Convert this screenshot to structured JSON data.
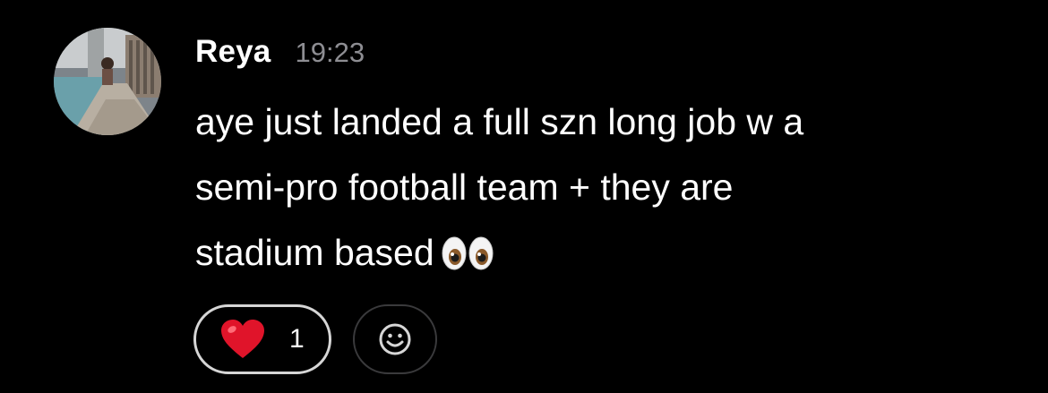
{
  "message": {
    "sender": "Reya",
    "time": "19:23",
    "text_lines": [
      "aye just landed a full szn long job w a",
      "semi-pro football team + they are",
      "stadium based"
    ],
    "trailing_emoji": "eyes-emoji"
  },
  "reactions": [
    {
      "emoji": "heart-emoji",
      "count": "1"
    }
  ],
  "add_reaction_icon": "smiley-face-icon",
  "colors": {
    "background": "#000000",
    "text": "#ffffff",
    "timestamp": "#8e8e93",
    "reaction_border": "#d6d6d6",
    "add_reaction_border": "#3a3a3c",
    "heart": "#e0142a"
  }
}
